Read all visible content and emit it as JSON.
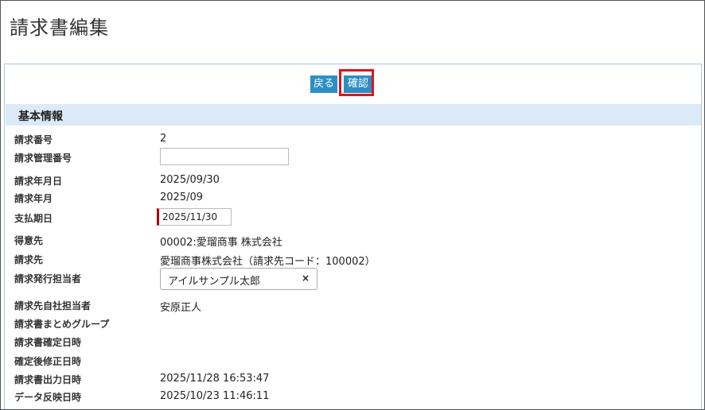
{
  "page": {
    "title": "請求書編集"
  },
  "toolbar": {
    "back_label": "戻る",
    "confirm_label": "確認"
  },
  "section": {
    "title": "基本情報"
  },
  "fields": {
    "invoice_no": {
      "label": "請求番号",
      "value": "2"
    },
    "invoice_mgmt_no": {
      "label": "請求管理番号",
      "value": ""
    },
    "invoice_date": {
      "label": "請求年月日",
      "value": "2025/09/30"
    },
    "invoice_month": {
      "label": "請求年月",
      "value": "2025/09"
    },
    "payment_due": {
      "label": "支払期日",
      "value": "2025/11/30"
    },
    "customer": {
      "label": "得意先",
      "value": "00002:愛瑠商事 株式会社"
    },
    "billing_to": {
      "label": "請求先",
      "value": "愛瑠商事株式会社（請求先コード：100002）"
    },
    "issuer": {
      "label": "請求発行担当者",
      "value": "アイルサンプル太郎",
      "clear": "×"
    },
    "billing_rep": {
      "label": "請求先自社担当者",
      "value": "安原正人"
    },
    "group": {
      "label": "請求書まとめグループ",
      "value": ""
    },
    "confirmed_at": {
      "label": "請求書確定日時",
      "value": ""
    },
    "modified_at": {
      "label": "確定後修正日時",
      "value": ""
    },
    "output_at": {
      "label": "請求書出力日時",
      "value": "2025/11/28 16:53:47"
    },
    "reflected_at": {
      "label": "データ反映日時",
      "value": "2025/10/23 11:46:11"
    }
  }
}
